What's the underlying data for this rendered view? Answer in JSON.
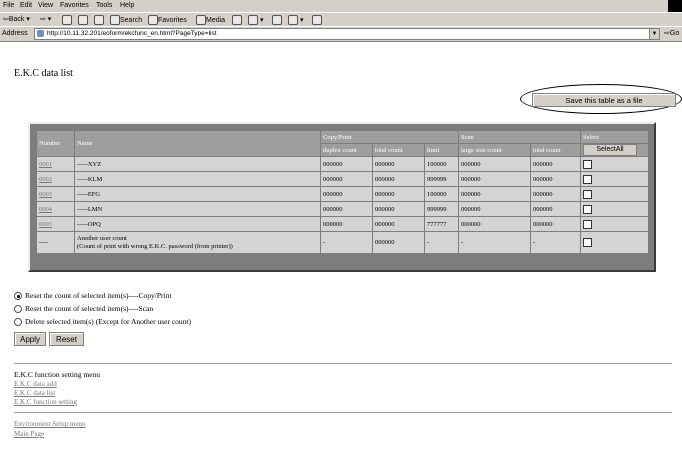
{
  "browser": {
    "menu": [
      "File",
      "Edit",
      "View",
      "Favorites",
      "Tools",
      "Help"
    ],
    "toolbar": {
      "back": "Back",
      "search": "Search",
      "favorites": "Favorites",
      "media": "Media"
    },
    "address_label": "Address",
    "url": "http://10.11.32.201/eoform/ekcfunc_en.html?PageType=list",
    "go": "Go"
  },
  "page": {
    "title": "E.K.C data list",
    "save_button": "Save this table as a file"
  },
  "table": {
    "col_number": "Number",
    "col_name": "Name",
    "group_copy": "Copy/Print",
    "group_scan": "Scan",
    "group_select": "Select",
    "sub_duplex": "duplex count",
    "sub_total": "total count",
    "sub_limit": "limit",
    "sub_large": "large size count",
    "sub_scan_total": "total count",
    "select_all": "SelectAll",
    "rows": [
      {
        "num": "0001",
        "name": "-----XYZ",
        "duplex": "000000",
        "total": "000000",
        "limit": "100000",
        "large": "000000",
        "scan_total": "000000"
      },
      {
        "num": "0002",
        "name": "-----KLM",
        "duplex": "000000",
        "total": "000000",
        "limit": "999999",
        "large": "000000",
        "scan_total": "000000"
      },
      {
        "num": "0003",
        "name": "-----EFG",
        "duplex": "000000",
        "total": "000000",
        "limit": "100000",
        "large": "000000",
        "scan_total": "000000"
      },
      {
        "num": "0004",
        "name": "-----LMN",
        "duplex": "000000",
        "total": "000000",
        "limit": "999999",
        "large": "000000",
        "scan_total": "000000"
      },
      {
        "num": "0005",
        "name": "-----OPQ",
        "duplex": "000000",
        "total": "000000",
        "limit": "777777",
        "large": "000000",
        "scan_total": "000000"
      }
    ],
    "other": {
      "num": "----",
      "name_line1": "Another user count",
      "name_line2": "(Count of print with wrong E.K.C. password (from printer))",
      "duplex": "-",
      "total": "000000",
      "limit": "-",
      "large": "-",
      "scan_total": "-"
    }
  },
  "options": {
    "reset_copy": "Reset the count of selected item(s)----Copy/Print",
    "reset_scan": "Reset the count of selected item(s)----Scan",
    "delete": "Delete selected item(s) (Except for Another user count)",
    "apply": "Apply",
    "reset": "Reset"
  },
  "menu": {
    "heading": "E.K.C function setting menu",
    "ekc_data_add": "E.K.C data add",
    "ekc_data_list": "E.K.C data list",
    "ekc_function_setting": "E.K.C function setting",
    "env_setup": "Environment Setup menu",
    "main_page": "Main Page"
  }
}
